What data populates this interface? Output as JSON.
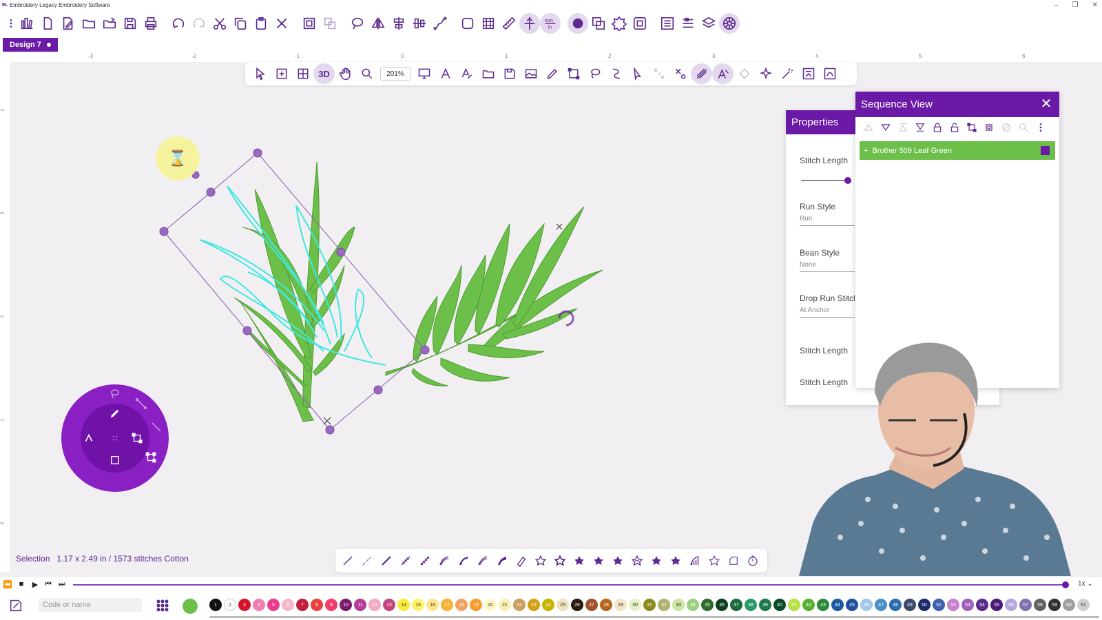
{
  "window": {
    "logo_text": "EL",
    "title": "Embroidery Legacy Embroidery Software",
    "minimize": "–",
    "restore": "❐",
    "close": "✕"
  },
  "main_toolbar_icons": [
    "more-vertical-icon",
    "library-icon",
    "new-file-icon",
    "edit-file-icon",
    "open-folder-icon",
    "open-recent-icon",
    "save-as-icon",
    "print-icon",
    "undo-icon",
    "redo-icon",
    "cut-icon",
    "copy-icon",
    "paste-icon",
    "delete-icon",
    "group-icon",
    "ungroup-icon",
    "lasso-icon",
    "mirror-icon",
    "align-icon",
    "distribute-icon",
    "path-icon",
    "hoop-icon",
    "grid-icon",
    "ruler-icon",
    "guides-icon",
    "units-icon",
    "circle-tool-icon",
    "applique-icon",
    "badge-icon",
    "frame-icon",
    "properties-icon",
    "sequence-icon",
    "layers-icon",
    "color-wheel-icon"
  ],
  "document": {
    "tab_label": "Design 7"
  },
  "ruler_top_labels": [
    "-3",
    "-2",
    "-1",
    "0",
    "1",
    "2",
    "3",
    "4",
    "5",
    "6"
  ],
  "ruler_left_labels": [
    "4",
    "3",
    "2",
    "1",
    "0"
  ],
  "float_toolbar": {
    "zoom": "201%",
    "view_3d_label": "3D"
  },
  "properties": {
    "title": "Properties",
    "fields": [
      {
        "label": "Stitch Length",
        "value": ""
      },
      {
        "label": "Run Style",
        "value": "Run"
      },
      {
        "label": "Bean Style",
        "value": "None"
      },
      {
        "label": "Drop Run Stitcl",
        "value": "At Anchor"
      },
      {
        "label": "Stitch Length",
        "value": ""
      },
      {
        "label": "Stitch Length",
        "value": ""
      }
    ]
  },
  "sequence_view": {
    "title": "Sequence View",
    "close_glyph": "✕",
    "items": [
      {
        "expander": "+",
        "label": "Brother 509 Leaf Green",
        "color": "#6cc04a"
      }
    ]
  },
  "status_bar": {
    "mode": "Selection",
    "info": "1.17 x 2.49 in / 1573 stitches Cotton"
  },
  "playback": {
    "speed": "1x"
  },
  "palette": {
    "search_placeholder": "Code or name",
    "selected_color": "#6cc04a",
    "swatches": [
      {
        "n": "1",
        "c": "#111111"
      },
      {
        "n": "2",
        "c": "#ffffff"
      },
      {
        "n": "3",
        "c": "#d3142a"
      },
      {
        "n": "4",
        "c": "#f27fb0"
      },
      {
        "n": "5",
        "c": "#ec3b8c"
      },
      {
        "n": "6",
        "c": "#f4b8c8"
      },
      {
        "n": "7",
        "c": "#c11f3b"
      },
      {
        "n": "8",
        "c": "#e8403e"
      },
      {
        "n": "9",
        "c": "#ef3e6b"
      },
      {
        "n": "10",
        "c": "#7c1b6c"
      },
      {
        "n": "11",
        "c": "#b43b97"
      },
      {
        "n": "12",
        "c": "#f5a8c2"
      },
      {
        "n": "13",
        "c": "#c2467c"
      },
      {
        "n": "14",
        "c": "#f7ec3a"
      },
      {
        "n": "15",
        "c": "#fff266"
      },
      {
        "n": "16",
        "c": "#fde68c"
      },
      {
        "n": "17",
        "c": "#f9b233"
      },
      {
        "n": "18",
        "c": "#f4a261"
      },
      {
        "n": "19",
        "c": "#f59c2a"
      },
      {
        "n": "20",
        "c": "#fff8c6"
      },
      {
        "n": "21",
        "c": "#fbf0b0"
      },
      {
        "n": "22",
        "c": "#c9a060"
      },
      {
        "n": "23",
        "c": "#d4a017"
      },
      {
        "n": "24",
        "c": "#c8b400"
      },
      {
        "n": "25",
        "c": "#f0e0c0"
      },
      {
        "n": "26",
        "c": "#2b1a0e"
      },
      {
        "n": "27",
        "c": "#a0522d"
      },
      {
        "n": "28",
        "c": "#b5651d"
      },
      {
        "n": "29",
        "c": "#f2e6c8"
      },
      {
        "n": "30",
        "c": "#e8f0c8"
      },
      {
        "n": "31",
        "c": "#8a8a1a"
      },
      {
        "n": "32",
        "c": "#b0b070"
      },
      {
        "n": "33",
        "c": "#c8e6a0"
      },
      {
        "n": "34",
        "c": "#9ad080"
      },
      {
        "n": "35",
        "c": "#2d6b2d"
      },
      {
        "n": "36",
        "c": "#0f3d1f"
      },
      {
        "n": "37",
        "c": "#1a6a3a"
      },
      {
        "n": "38",
        "c": "#2a9a6a"
      },
      {
        "n": "39",
        "c": "#1c7a4a"
      },
      {
        "n": "40",
        "c": "#0a4a2a"
      },
      {
        "n": "41",
        "c": "#b8e04a"
      },
      {
        "n": "42",
        "c": "#5ab030"
      },
      {
        "n": "43",
        "c": "#2a8a3a"
      },
      {
        "n": "44",
        "c": "#1a5aa0"
      },
      {
        "n": "45",
        "c": "#2050a0"
      },
      {
        "n": "46",
        "c": "#a0c8e8"
      },
      {
        "n": "47",
        "c": "#4a90c8"
      },
      {
        "n": "48",
        "c": "#2a6ab0"
      },
      {
        "n": "49",
        "c": "#3a4a6a"
      },
      {
        "n": "50",
        "c": "#1a2a6a"
      },
      {
        "n": "51",
        "c": "#4060b0"
      },
      {
        "n": "52",
        "c": "#c880d0"
      },
      {
        "n": "53",
        "c": "#a060b8"
      },
      {
        "n": "54",
        "c": "#5a2a8a"
      },
      {
        "n": "55",
        "c": "#4a1a7a"
      },
      {
        "n": "56",
        "c": "#b8a8e0"
      },
      {
        "n": "57",
        "c": "#8070b0"
      },
      {
        "n": "58",
        "c": "#606060"
      },
      {
        "n": "59",
        "c": "#303030"
      },
      {
        "n": "60",
        "c": "#a0a0a0"
      },
      {
        "n": "61",
        "c": "#d0d0d0"
      }
    ]
  },
  "colors": {
    "accent": "#6a1aa6",
    "leaf_green": "#6cc04a",
    "selected_outline": "#3ee8e0"
  }
}
